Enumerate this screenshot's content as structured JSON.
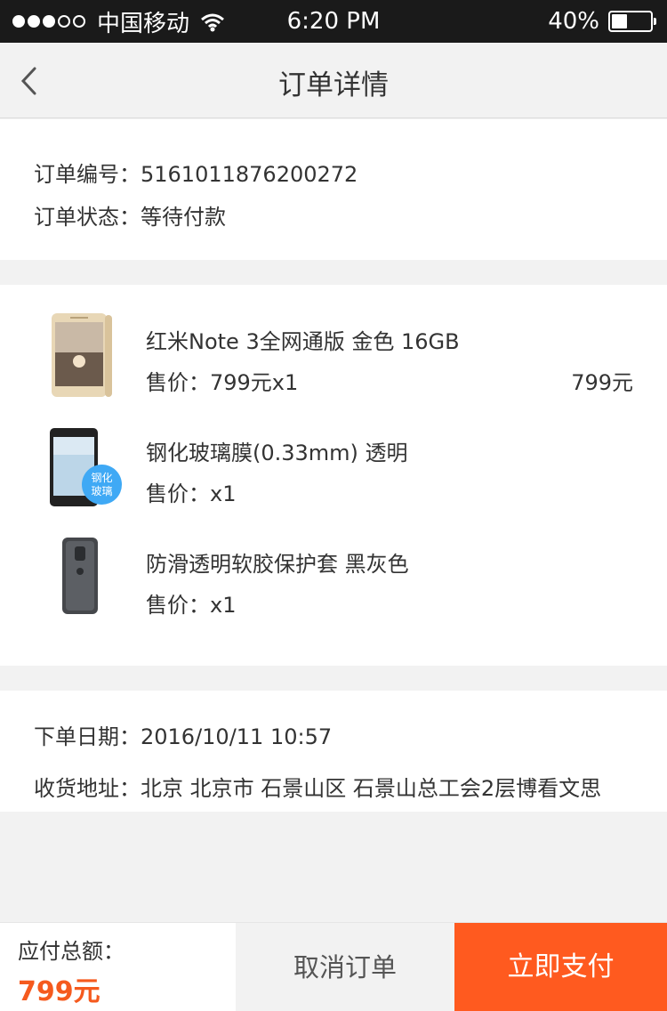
{
  "status_bar": {
    "carrier": "中国移动",
    "time": "6:20 PM",
    "battery_text": "40%",
    "battery_level": 0.4,
    "signal_bars_filled": 3,
    "signal_bars_total": 5
  },
  "nav": {
    "title": "订单详情",
    "back_icon": "chevron-left-icon"
  },
  "order": {
    "number_label": "订单编号：",
    "number": "5161011876200272",
    "status_label": "订单状态：",
    "status": "等待付款"
  },
  "products": [
    {
      "name": "红米Note 3全网通版 金色 16GB",
      "price": "售价：799元x1",
      "total": "799元",
      "thumb": "gold-phone-thumbnail"
    },
    {
      "name": "钢化玻璃膜(0.33mm) 透明",
      "price": "售价：x1",
      "total": "",
      "thumb": "tempered-glass-thumbnail",
      "badge": [
        "钢化",
        "玻璃"
      ]
    },
    {
      "name": "防滑透明软胶保护套 黑灰色",
      "price": "售价：x1",
      "total": "",
      "thumb": "phone-case-thumbnail"
    }
  ],
  "meta": {
    "date_label": "下单日期：",
    "date": "2016/10/11 10:57",
    "address_label": "收货地址：",
    "address": "北京 北京市 石景山区 石景山总工会2层博看文思"
  },
  "bottom": {
    "total_label": "应付总额：",
    "total_value": "799元",
    "cancel_label": "取消订单",
    "pay_label": "立即支付"
  },
  "colors": {
    "accent": "#ff5a1f",
    "price_accent": "#f55a1e",
    "status_bar_bg": "#1a1a1a"
  }
}
